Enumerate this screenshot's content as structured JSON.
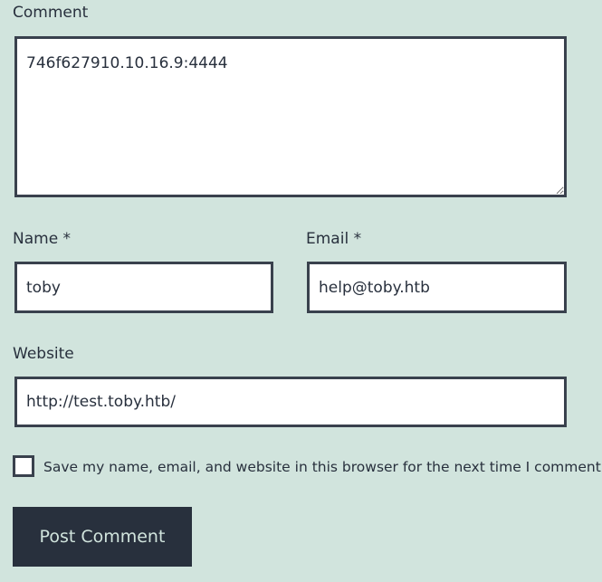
{
  "comment": {
    "label": "Comment",
    "value": "746f627910.10.16.9:4444"
  },
  "name": {
    "label": "Name *",
    "value": "toby"
  },
  "email": {
    "label": "Email *",
    "value": "help@toby.htb"
  },
  "website": {
    "label": "Website",
    "value": "http://test.toby.htb/"
  },
  "save_consent": {
    "label": "Save my name, email, and website in this browser for the next time I comment.",
    "checked": false
  },
  "submit": {
    "label": "Post Comment"
  },
  "colors": {
    "background": "#d1e4dd",
    "text": "#28303d",
    "border": "#39414d",
    "button_bg": "#28303d",
    "button_text": "#d1e4dd"
  }
}
